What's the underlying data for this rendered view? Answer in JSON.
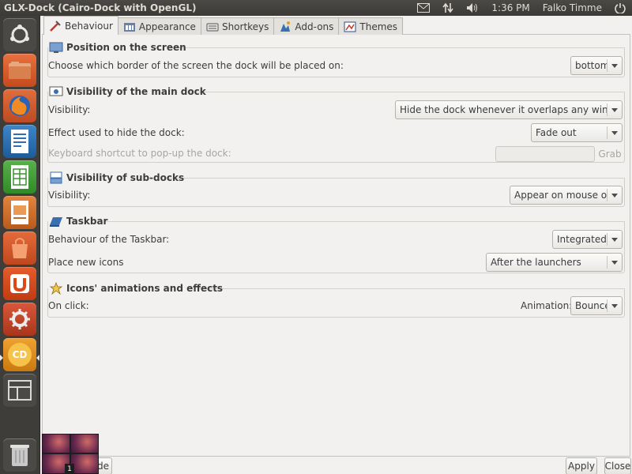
{
  "window_title": "GLX-Dock (Cairo-Dock with OpenGL)",
  "panel": {
    "time": "1:36 PM",
    "user": "Falko Timme",
    "icons": [
      "mail-icon",
      "network-icon",
      "volume-icon",
      "power-icon"
    ]
  },
  "launcher": {
    "items": [
      "dash-home-icon",
      "files-icon",
      "firefox-icon",
      "writer-icon",
      "calc-icon",
      "impress-icon",
      "software-center-icon",
      "ubuntu-one-icon",
      "system-settings-icon",
      "cairo-dock-icon",
      "workspace-switcher-icon",
      "trash-icon"
    ],
    "cairo_dock_label": "CD"
  },
  "tabs": [
    {
      "label": "Behaviour",
      "icon": "behaviour-icon",
      "active": true
    },
    {
      "label": "Appearance",
      "icon": "appearance-icon",
      "active": false
    },
    {
      "label": "Shortkeys",
      "icon": "shortkeys-icon",
      "active": false
    },
    {
      "label": "Add-ons",
      "icon": "addons-icon",
      "active": false
    },
    {
      "label": "Themes",
      "icon": "themes-icon",
      "active": false
    }
  ],
  "sections": {
    "position": {
      "title": "Position on the screen",
      "row_label": "Choose which border of the screen the dock will be placed on:",
      "value": "bottom"
    },
    "visibility_main": {
      "title": "Visibility of the main dock",
      "visibility_label": "Visibility:",
      "visibility_value": "Hide the dock whenever it overlaps any windows",
      "effect_label": "Effect used to hide the dock:",
      "effect_value": "Fade out",
      "shortcut_label": "Keyboard shortcut to pop-up the dock:",
      "shortcut_value": "",
      "grab_label": "Grab"
    },
    "visibility_sub": {
      "title": "Visibility of sub-docks",
      "visibility_label": "Visibility:",
      "visibility_value": "Appear on mouse over"
    },
    "taskbar": {
      "title": "Taskbar",
      "behaviour_label": "Behaviour of the Taskbar:",
      "behaviour_value": "Integrated",
      "place_label": "Place new icons",
      "place_value": "After the launchers"
    },
    "animations": {
      "title": "Icons' animations and effects",
      "onclick_label": "On click:",
      "animation_label": "Animation:",
      "animation_value": "Bounce"
    }
  },
  "bottom": {
    "mode_partial_label": "de",
    "apply_label": "Apply",
    "close_label": "Close",
    "workspace_number": "1"
  },
  "colors": {
    "panel_bg": "#3c3b37",
    "launcher_bg": "#3e3d3a",
    "window_bg": "#f2f1f0"
  }
}
